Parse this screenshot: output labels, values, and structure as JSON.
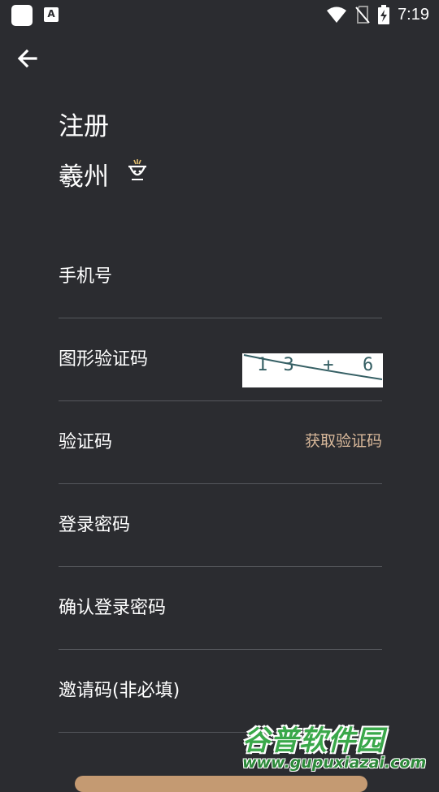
{
  "status_bar": {
    "a_icon": "A",
    "time": "7:19",
    "icons": [
      "app-square-icon",
      "a-notification-icon",
      "wifi-icon",
      "no-sim-icon",
      "battery-charging-icon"
    ]
  },
  "header": {
    "back_icon": "arrow-left-icon"
  },
  "title": "注册",
  "brand": {
    "name": "羲州",
    "logo_text": "羲州"
  },
  "form": {
    "phone_label": "手机号",
    "captcha_label": "图形验证码",
    "captcha_text": "1 3  +  6  =",
    "code_label": "验证码",
    "get_code_label": "获取验证码",
    "password_label": "登录密码",
    "confirm_password_label": "确认登录密码",
    "invite_label": "邀请码(非必填)"
  },
  "watermark": {
    "title": "谷普软件园",
    "url": "www.gupuxiazai.com"
  },
  "colors": {
    "background": "#2b2c30",
    "accent": "#d8b89a",
    "divider": "#55575c"
  }
}
